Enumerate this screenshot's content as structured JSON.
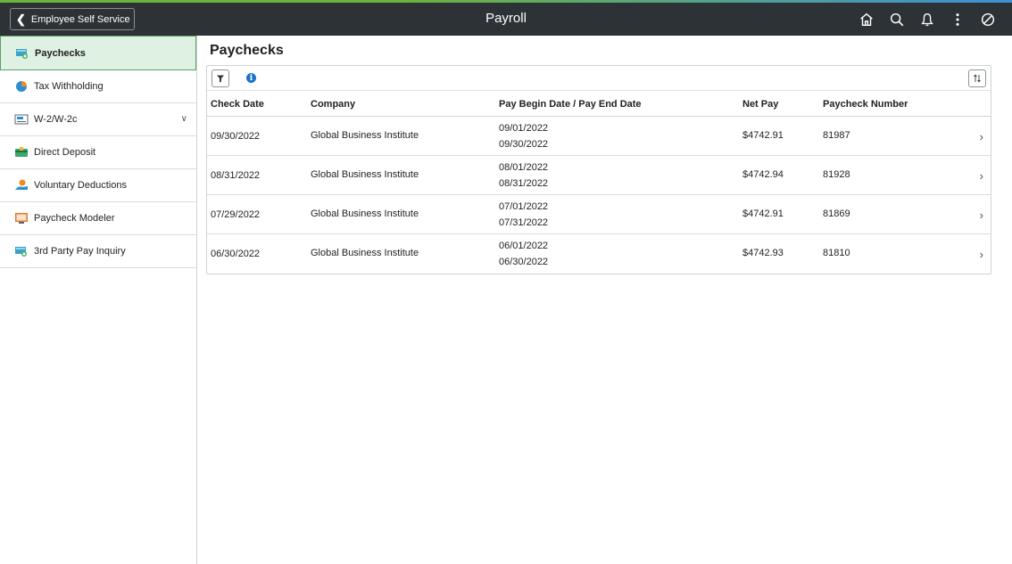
{
  "header": {
    "back_label": "Employee Self Service",
    "title": "Payroll",
    "icons": [
      "home-icon",
      "search-icon",
      "bell-icon",
      "more-icon",
      "no-entry-icon"
    ]
  },
  "sidebar": {
    "items": [
      {
        "label": "Paychecks",
        "icon": "paycheck-icon",
        "active": true
      },
      {
        "label": "Tax Withholding",
        "icon": "pie-chart-icon"
      },
      {
        "label": "W-2/W-2c",
        "icon": "w2-form-icon",
        "expandable": true
      },
      {
        "label": "Direct Deposit",
        "icon": "direct-deposit-icon"
      },
      {
        "label": "Voluntary Deductions",
        "icon": "voluntary-deductions-icon"
      },
      {
        "label": "Paycheck Modeler",
        "icon": "paycheck-modeler-icon"
      },
      {
        "label": "3rd Party Pay Inquiry",
        "icon": "third-party-pay-icon"
      }
    ]
  },
  "main": {
    "title": "Paychecks",
    "columns": [
      "Check Date",
      "Company",
      "Pay Begin Date / Pay End Date",
      "Net Pay",
      "Paycheck Number"
    ],
    "rows": [
      {
        "check_date": "09/30/2022",
        "company": "Global Business Institute",
        "begin": "09/01/2022",
        "end": "09/30/2022",
        "net_pay": "$4742.91",
        "number": "81987"
      },
      {
        "check_date": "08/31/2022",
        "company": "Global Business Institute",
        "begin": "08/01/2022",
        "end": "08/31/2022",
        "net_pay": "$4742.94",
        "number": "81928"
      },
      {
        "check_date": "07/29/2022",
        "company": "Global Business Institute",
        "begin": "07/01/2022",
        "end": "07/31/2022",
        "net_pay": "$4742.91",
        "number": "81869"
      },
      {
        "check_date": "06/30/2022",
        "company": "Global Business Institute",
        "begin": "06/01/2022",
        "end": "06/30/2022",
        "net_pay": "$4742.93",
        "number": "81810"
      }
    ]
  },
  "colors": {
    "header_bg": "#2d3236",
    "active_item_bg": "#dff1e3",
    "active_item_border": "#5aa36a",
    "info_blue": "#1a73c8"
  }
}
